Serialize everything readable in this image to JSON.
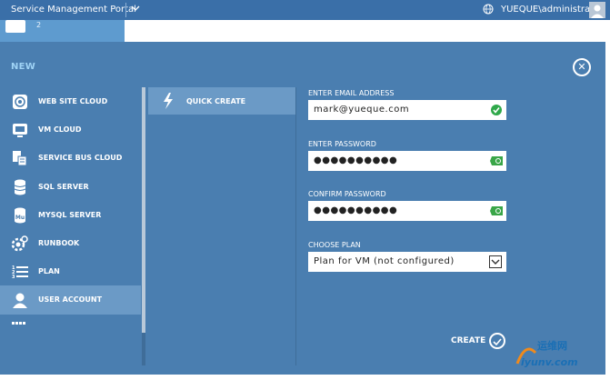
{
  "topbar": {
    "title": "Service Management Portal",
    "user": "YUEQUE\\administrator",
    "menu_chevron_icon": "chevron-down-icon",
    "globe_icon": "globe-icon",
    "avatar_icon": "avatar-icon"
  },
  "background": {
    "tile_count": "2"
  },
  "drawer": {
    "title": "NEW",
    "close_icon": "close-icon",
    "categories": [
      {
        "label": "WEB SITE CLOUD",
        "icon": "website-icon"
      },
      {
        "label": "VM CLOUD",
        "icon": "monitor-icon"
      },
      {
        "label": "SERVICE BUS CLOUD",
        "icon": "service-bus-icon"
      },
      {
        "label": "SQL SERVER",
        "icon": "database-icon"
      },
      {
        "label": "MYSQL SERVER",
        "icon": "mysql-icon"
      },
      {
        "label": "RUNBOOK",
        "icon": "gear-icon"
      },
      {
        "label": "PLAN",
        "icon": "list-icon"
      },
      {
        "label": "USER ACCOUNT",
        "icon": "user-icon",
        "selected": true
      }
    ],
    "sub_options": [
      {
        "label": "QUICK CREATE",
        "icon": "lightning-icon"
      }
    ],
    "form": {
      "email_label": "ENTER EMAIL ADDRESS",
      "email_value": "mark@yueque.com",
      "password_label": "ENTER PASSWORD",
      "password_value": "●●●●●●●●●●",
      "confirm_label": "CONFIRM PASSWORD",
      "confirm_value": "●●●●●●●●●●",
      "plan_label": "CHOOSE PLAN",
      "plan_value": "Plan for VM (not configured)"
    },
    "create_label": "CREATE"
  },
  "watermark": {
    "line1": "运维网",
    "line2": "iyunv.com"
  },
  "colors": {
    "drawer": "#4a7eb0",
    "selected": "#6b9ac6",
    "accent_label": "#9fd3f5",
    "valid": "#2fa84a"
  }
}
